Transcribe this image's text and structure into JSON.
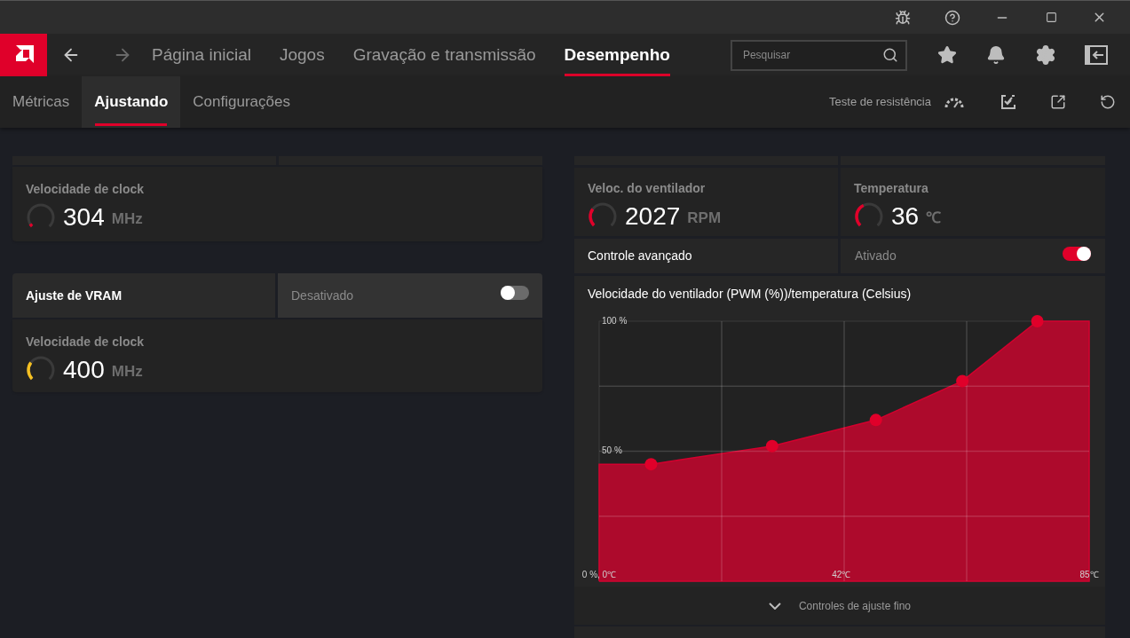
{
  "nav": {
    "items": [
      {
        "label": "Página inicial",
        "selected": false
      },
      {
        "label": "Jogos",
        "selected": false
      },
      {
        "label": "Gravação e transmissão",
        "selected": false
      },
      {
        "label": "Desempenho",
        "selected": true
      }
    ],
    "search": {
      "placeholder": "Pesquisar"
    }
  },
  "subnav": {
    "tabs": [
      {
        "label": "Métricas",
        "selected": false
      },
      {
        "label": "Ajustando",
        "selected": true
      },
      {
        "label": "Configurações",
        "selected": false
      }
    ],
    "stress_test": "Teste de resistência"
  },
  "left": {
    "gpu_clock": {
      "label": "Velocidade de clock",
      "value": "304",
      "unit": "MHz",
      "level": 0.05,
      "color": "#e0002a"
    },
    "vram": {
      "title": "Ajuste de VRAM",
      "status": "Desativado",
      "on": false,
      "clock": {
        "label": "Velocidade de clock",
        "value": "400",
        "unit": "MHz",
        "level": 0.3,
        "color": "#f5c022"
      }
    }
  },
  "right": {
    "fan_speed": {
      "label": "Veloc. do ventilador",
      "value": "2027",
      "unit": "RPM",
      "level": 0.3,
      "color": "#e0002a"
    },
    "temperature": {
      "label": "Temperatura",
      "value": "36",
      "unit": "℃",
      "level": 0.4,
      "color": "#e0002a"
    },
    "advanced": {
      "label": "Controle avançado",
      "status": "Ativado",
      "on": true
    },
    "curve": {
      "title": "Velocidade do ventilador (PWM (%))/temperatura (Celsius)",
      "chart_data": {
        "type": "area",
        "x": [
          0,
          9,
          30,
          48,
          63,
          76,
          85
        ],
        "series": [
          {
            "color": "#ad0a2c",
            "values": [
              45,
              45,
              52,
              62,
              77,
              100,
              100
            ]
          }
        ],
        "xlim": [
          0,
          85
        ],
        "ylim": [
          0,
          100
        ],
        "xticks": [
          {
            "value": 0,
            "label": "0 %, 0℃"
          },
          {
            "value": 42,
            "label": "42℃"
          },
          {
            "value": 85,
            "label": "85℃"
          }
        ],
        "yticks": [
          {
            "value": 50,
            "label": "50 %"
          },
          {
            "value": 100,
            "label": "100 %"
          }
        ]
      },
      "fine_tune": "Controles de ajuste fino"
    }
  }
}
